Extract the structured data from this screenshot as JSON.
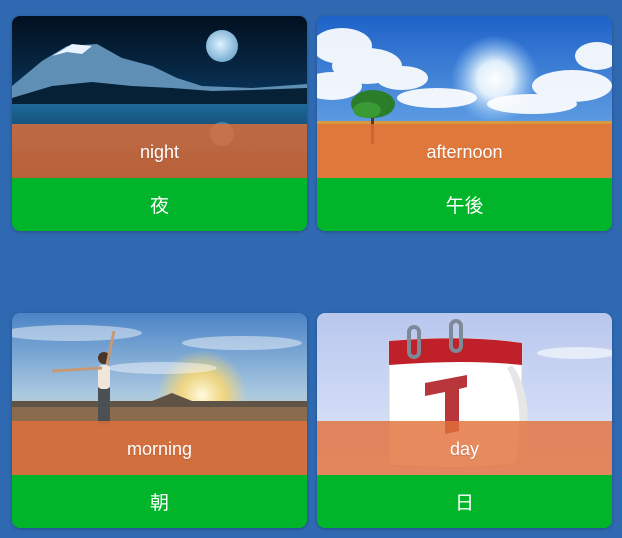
{
  "cards": [
    {
      "english": "night",
      "japanese": "夜",
      "image": "night-lake-moon-photo"
    },
    {
      "english": "afternoon",
      "japanese": "午後",
      "image": "sunny-sky-tree-field-photo"
    },
    {
      "english": "morning",
      "japanese": "朝",
      "image": "woman-beach-sunrise-photo"
    },
    {
      "english": "day",
      "japanese": "日",
      "image": "calendar-page-1-icon"
    }
  ]
}
